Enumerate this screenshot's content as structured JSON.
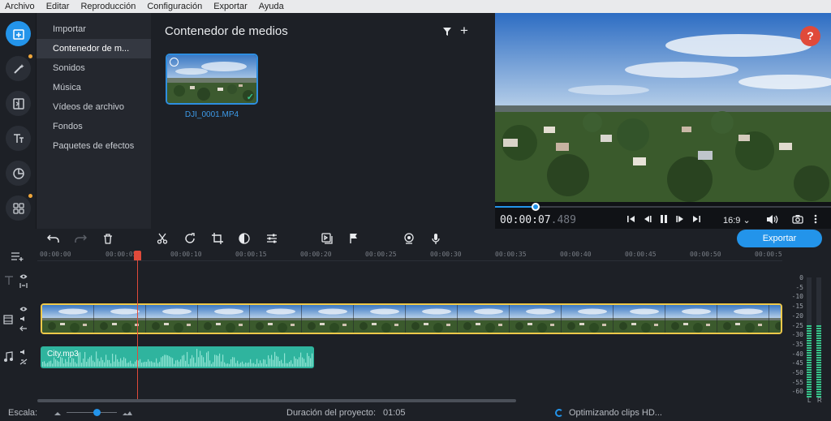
{
  "menu": [
    "Archivo",
    "Editar",
    "Reproducción",
    "Configuración",
    "Exportar",
    "Ayuda"
  ],
  "categories": [
    {
      "label": "Importar",
      "selected": false
    },
    {
      "label": "Contenedor de m...",
      "selected": true
    },
    {
      "label": "Sonidos",
      "selected": false
    },
    {
      "label": "Música",
      "selected": false
    },
    {
      "label": "Vídeos de archivo",
      "selected": false
    },
    {
      "label": "Fondos",
      "selected": false
    },
    {
      "label": "Paquetes de efectos",
      "selected": false
    }
  ],
  "media": {
    "title": "Contenedor de medios",
    "file_name": "DJI_0001.MP4"
  },
  "preview": {
    "help": "?",
    "timecode_main": "00:00:07",
    "timecode_ms": ".489",
    "aspect": "16:9",
    "progress_fraction": 0.12
  },
  "toolbar": {
    "export_label": "Exportar"
  },
  "ruler": [
    "00:00:00",
    "00:00:05",
    "00:00:10",
    "00:00:15",
    "00:00:20",
    "00:00:25",
    "00:00:30",
    "00:00:35",
    "00:00:40",
    "00:00:45",
    "00:00:50",
    "00:00:5"
  ],
  "tracks": {
    "audio_clip_name": "City.mp3"
  },
  "meters": {
    "scale": [
      "0",
      "-5",
      "-10",
      "-15",
      "-20",
      "-25",
      "-30",
      "-35",
      "-40",
      "-45",
      "-50",
      "-55",
      "-60"
    ],
    "left_label": "L",
    "right_label": "R",
    "left_level": 0.6,
    "right_level": 0.6
  },
  "status": {
    "scale_label": "Escala:",
    "duration_label": "Duración del proyecto:",
    "duration_value": "01:05",
    "optimizing": "Optimizando clips HD..."
  },
  "colors": {
    "accent": "#2394ea",
    "playhead": "#e04a3a",
    "audio_clip": "#2fb49e",
    "video_clip_border": "#f0c94a"
  }
}
